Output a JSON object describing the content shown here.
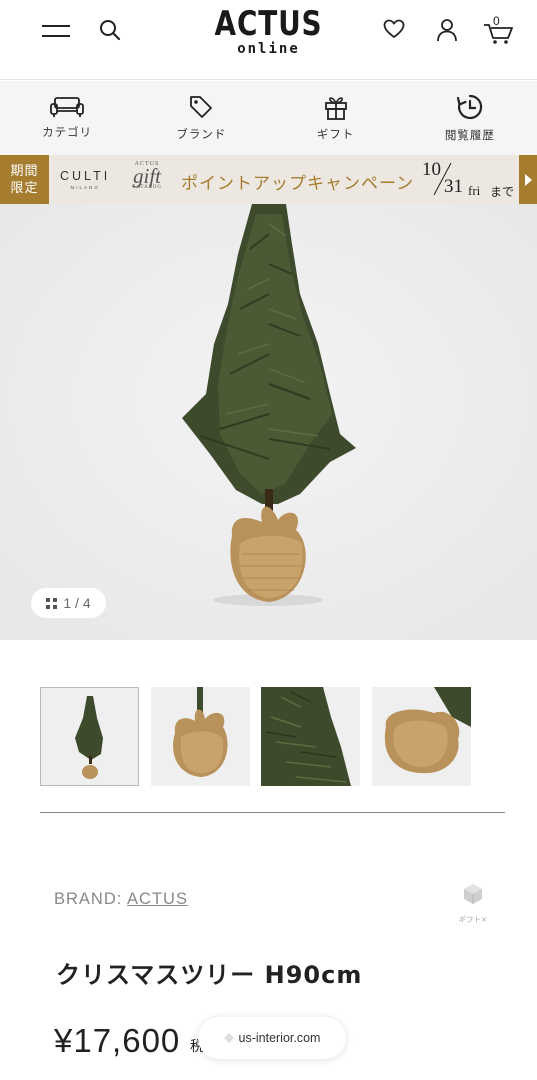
{
  "header": {
    "logo_main": "ACTUS",
    "logo_sub": "online",
    "cart_count": "0",
    "icons": [
      "menu-icon",
      "search-icon",
      "heart-icon",
      "account-icon",
      "cart-icon"
    ]
  },
  "category_nav": [
    {
      "label": "カテゴリ",
      "icon": "sofa-icon"
    },
    {
      "label": "ブランド",
      "icon": "tag-icon"
    },
    {
      "label": "ギフト",
      "icon": "gift-icon"
    },
    {
      "label": "閲覧履歴",
      "icon": "history-icon"
    }
  ],
  "banner": {
    "limited_line1": "期間",
    "limited_line2": "限定",
    "culti_main": "CULTI",
    "culti_sub": "MILANO",
    "gift_actus": "ACTUS",
    "gift_word": "gift",
    "gift_catalog": "CATALOG",
    "campaign_text": "ポイントアップキャンペーン",
    "date_month": "10",
    "date_day": "31",
    "date_weekday": "fri",
    "date_suffix": "まで",
    "accent_color": "#a67c2e"
  },
  "gallery": {
    "counter": "1 / 4",
    "thumbnail_count": 4,
    "active_index": 1
  },
  "product": {
    "brand_prefix": "BRAND: ",
    "brand_name": "ACTUS",
    "gift_badge_label": "ギフト×",
    "title": "クリスマスツリー H90cm",
    "price": "¥17,600",
    "price_tax": "税"
  },
  "browser": {
    "url_text": "us-interior.com"
  }
}
